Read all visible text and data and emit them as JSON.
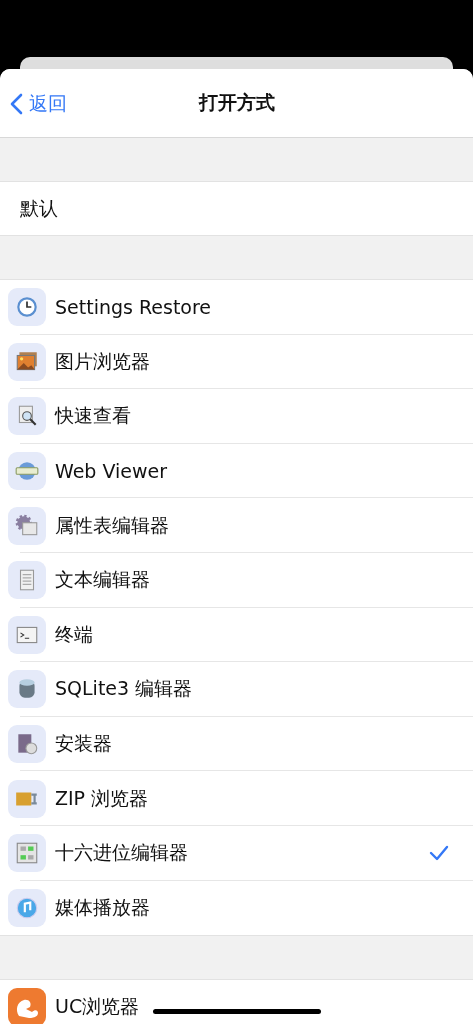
{
  "nav": {
    "back": "返回",
    "title": "打开方式"
  },
  "default_section": {
    "label": "默认"
  },
  "apps": [
    {
      "name": "Settings Restore",
      "selected": false
    },
    {
      "name": "图片浏览器",
      "selected": false
    },
    {
      "name": "快速查看",
      "selected": false
    },
    {
      "name": "Web Viewer",
      "selected": false
    },
    {
      "name": "属性表编辑器",
      "selected": false
    },
    {
      "name": "文本编辑器",
      "selected": false
    },
    {
      "name": "终端",
      "selected": false
    },
    {
      "name": "SQLite3 编辑器",
      "selected": false
    },
    {
      "name": "安装器",
      "selected": false
    },
    {
      "name": "ZIP 浏览器",
      "selected": false
    },
    {
      "name": "十六进位编辑器",
      "selected": true
    },
    {
      "name": "媒体播放器",
      "selected": false
    }
  ],
  "other_apps": [
    {
      "name": "UC浏览器",
      "selected": false
    }
  ]
}
